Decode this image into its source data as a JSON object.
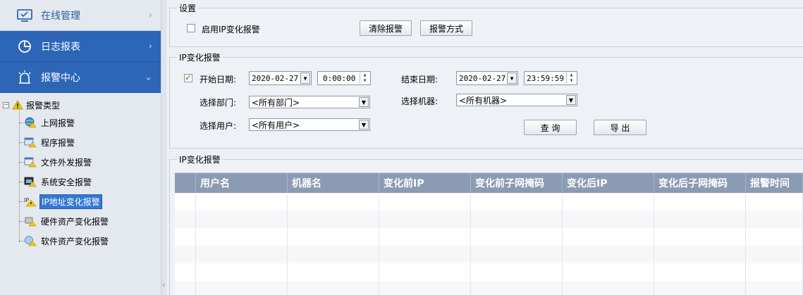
{
  "sidebar": {
    "nav": [
      {
        "label": "在线管理",
        "icon": "monitor-icon",
        "style": "light",
        "chevron": "›"
      },
      {
        "label": "日志报表",
        "icon": "pie-chart-icon",
        "style": "dark",
        "chevron": "›"
      },
      {
        "label": "报警中心",
        "icon": "alarm-icon",
        "style": "dark",
        "chevron": "⌄"
      }
    ],
    "tree": {
      "root_label": "报警类型",
      "expander": "−",
      "items": [
        {
          "label": "上网报警",
          "icon": "globe-warning-icon"
        },
        {
          "label": "程序报警",
          "icon": "program-warning-icon"
        },
        {
          "label": "文件外发报警",
          "icon": "file-warning-icon"
        },
        {
          "label": "系统安全报警",
          "icon": "system-warning-icon"
        },
        {
          "label": "IP地址变化报警",
          "icon": "ip-warning-icon",
          "selected": true
        },
        {
          "label": "硬件资产变化报警",
          "icon": "hardware-warning-icon"
        },
        {
          "label": "软件资产变化报警",
          "icon": "software-warning-icon"
        }
      ]
    },
    "splitter_arrow": "‹"
  },
  "settings": {
    "legend": "设置",
    "enable_label": "启用IP变化报警",
    "enable_checked": false,
    "clear_button": "清除报警",
    "method_button": "报警方式"
  },
  "filter": {
    "legend": "IP变化报警",
    "start_checked": true,
    "start_label": "开始日期:",
    "start_date": "2020-02-27",
    "start_time": "0:00:00",
    "end_label": "结束日期:",
    "end_date": "2020-02-27",
    "end_time": "23:59:59",
    "dept_label": "选择部门:",
    "dept_value": "<所有部门>",
    "machine_label": "选择机器:",
    "machine_value": "<所有机器>",
    "user_label": "选择用户:",
    "user_value": "<所有用户>",
    "query_button": "查 询",
    "export_button": "导 出"
  },
  "results": {
    "legend": "IP变化报警",
    "columns": [
      "",
      "用户名",
      "机器名",
      "变化前IP",
      "变化前子网掩码",
      "变化后IP",
      "变化后子网掩码",
      "报警时间"
    ],
    "rows": [
      [],
      [],
      [],
      [],
      [],
      []
    ]
  },
  "colors": {
    "nav_active": "#2d66b7",
    "nav_text_light": "#2a5d9c",
    "table_header": "#8a9bb3",
    "selected_item": "#3478d4"
  }
}
